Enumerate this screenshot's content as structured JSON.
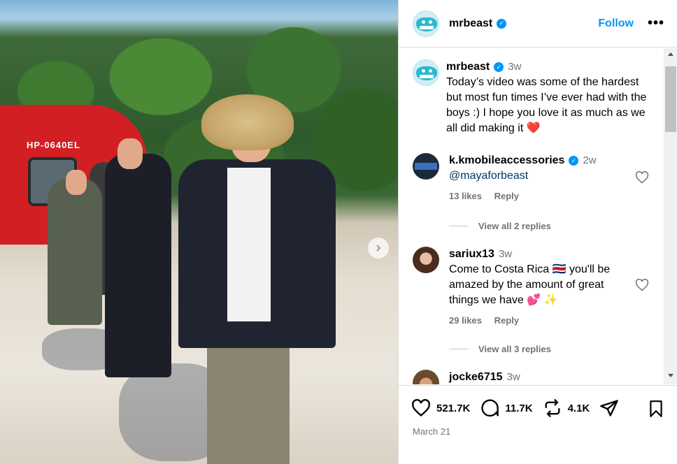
{
  "post": {
    "username": "mrbeast",
    "follow_label": "Follow",
    "more_label": "•••",
    "caption": {
      "username": "mrbeast",
      "time": "3w",
      "text": "Today’s video was some of the hardest but most fun times I’ve ever had with the boys :) I hope you love it as much as we all did making it ❤️"
    },
    "photo": {
      "heli_text": "HP-0640EL"
    }
  },
  "comments": [
    {
      "username": "k.kmobileaccessories",
      "verified": true,
      "time": "2w",
      "text": "@mayaforbeast",
      "likes": "13 likes",
      "reply": "Reply",
      "view_replies": "View all 2 replies"
    },
    {
      "username": "sariux13",
      "verified": false,
      "time": "3w",
      "text": "Come to Costa Rica 🇨🇷 you'll be amazed by the amount of great things we have 💕 ✨",
      "likes": "29 likes",
      "reply": "Reply",
      "view_replies": "View all 3 replies"
    },
    {
      "username": "jocke6715",
      "verified": false,
      "time": "3w"
    }
  ],
  "actions": {
    "likes": "521.7K",
    "comments": "11.7K",
    "reposts": "4.1K",
    "date": "March 21"
  },
  "icons": {
    "verified": "verified-badge-icon",
    "heart": "heart-icon",
    "comment": "comment-icon",
    "repost": "repost-icon",
    "share": "share-icon",
    "save": "bookmark-icon",
    "next": "chevron-right-icon"
  },
  "colors": {
    "accent": "#0095f6",
    "verified": "#0095f6",
    "secondary_text": "#737373",
    "link": "#00376b"
  }
}
